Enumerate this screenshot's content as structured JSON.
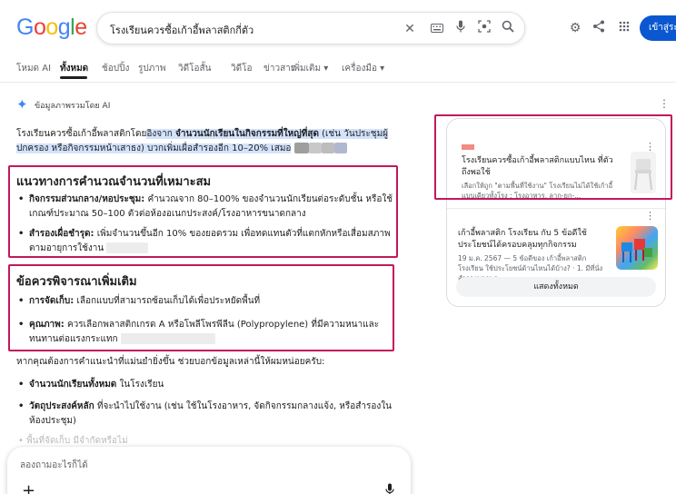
{
  "header": {
    "logo": "Google",
    "query": "โรงเรียนควรซื้อเก้าอี้พลาสติกกี่ตัว",
    "login_label": "เข้าสู่ระบบ"
  },
  "icons": {
    "clear": "close-icon",
    "keyboard": "keyboard-icon",
    "mic": "microphone-icon",
    "lens": "camera-lens-icon",
    "search": "search-icon",
    "settings": "gear-icon",
    "share": "share-icon",
    "apps": "apps-grid-icon"
  },
  "tabs": [
    {
      "label": "โหมด AI"
    },
    {
      "label": "ทั้งหมด",
      "active": true
    },
    {
      "label": "ช้อปปิ้ง"
    },
    {
      "label": "รูปภาพ"
    },
    {
      "label": "วิดีโอสั้น"
    },
    {
      "label": "วิดีโอ"
    },
    {
      "label": "ข่าวสาร"
    },
    {
      "label": "เพิ่มเติม ▾"
    },
    {
      "label": "เครื่องมือ ▾"
    }
  ],
  "ai_overview": {
    "label": "ข้อมูลภาพรวมโดย AI",
    "intro_plain": "โรงเรียนควรซื้อเก้าอี้พลาสติกโดย",
    "intro_hl1": "อิงจาก ",
    "intro_hl_bold": "จำนวนนักเรียนในกิจกรรมที่ใหญ่ที่สุด",
    "intro_hl2": " (เช่น วันประชุมผู้",
    "intro_line2_hl": "ปกครอง หรือกิจกรรมหน้าเสาธง) บวกเพิ่มเผื่อสำรองอีก 10–20% เสมอ",
    "section1": {
      "title": "แนวทางการคำนวณจำนวนที่เหมาะสม",
      "b1_bold": "กิจกรรมส่วนกลาง/หอประชุม:",
      "b1_line1": " คำนวณจาก 80–100% ของจำนวนนักเรียนต่อระดับชั้น หรือใช้",
      "b1_line2": "เกณฑ์ประมาณ 50–100 ตัวต่อห้องอเนกประสงค์/โรงอาหารขนาดกลาง",
      "b2_bold": "สำรองเผื่อชำรุด:",
      "b2_line1": " เพิ่มจำนวนขึ้นอีก 10% ของยอดรวม เพื่อทดแทนตัวที่แตกหักหรือเสื่อมสภาพ",
      "b2_line2": "ตามอายุการใช้งาน"
    },
    "section2": {
      "title": "ข้อควรพิจารณาเพิ่มเติม",
      "b1_bold": "การจัดเก็บ:",
      "b1_text": " เลือกแบบที่สามารถซ้อนเก็บได้เพื่อประหยัดพื้นที่",
      "b2_bold": "คุณภาพ:",
      "b2_line1": " ควรเลือกพลาสติกเกรด A หรือโพลีโพรพีลีน (Polypropylene) ที่มีความหนาและ",
      "b2_line2": "ทนทานต่อแรงกระแทก"
    },
    "followup": "หากคุณต้องการคำแนะนำที่แม่นยำยิ่งขึ้น ช่วยบอกข้อมูลเหล่านี้ให้ผมหน่อยครับ:",
    "fu_b1_bold": "จำนวนนักเรียนทั้งหมด",
    "fu_b1_text": " ในโรงเรียน",
    "fu_b2_bold": "วัตถุประสงค์หลัก",
    "fu_b2_line1": " ที่จะนำไปใช้งาน (เช่น ใช้ในโรงอาหาร, จัดกิจกรรมกลางแจ้ง, หรือสำรองใน",
    "fu_b2_line2": "ห้องประชุม)",
    "fu_b3": "พื้นที่จัดเก็บ มีจำกัดหรือไม่"
  },
  "ask": {
    "placeholder": "ลองถามอะไรก็ได้"
  },
  "right_panel": {
    "card1_title": "โรงเรียนควรซื้อเก้าอี้พลาสติกแบบไหน ที่ตัวถึงพอใช้",
    "card1_desc": "เลือกให้ถูก \"ตามพื้นที่ใช้งาน\" โรงเรียนไม่ได้ใช้เก้าอี้แบบเดียวทั้งโรง ; โรงอาหาร, ลาก-ยก-...",
    "card2_title": "เก้าอี้พลาสติก โรงเรียน กับ 5 ข้อดีใช้ประโยชน์ได้ครอบคลุมทุกกิจกรรม",
    "card2_desc": "19 ม.ค. 2567 — 5 ข้อดีของ เก้าอี้พลาสติก โรงเรียน ใช้ประโยชน์ด้านไหนได้บ้าง? · 1. มีที่นั่งสำรองมากพอ",
    "show_all": "แสดงทั้งหมด"
  },
  "colors": {
    "accent": "#0b57d0",
    "highlight": "#d3e3fd",
    "annotation_box": "#c2185b"
  }
}
